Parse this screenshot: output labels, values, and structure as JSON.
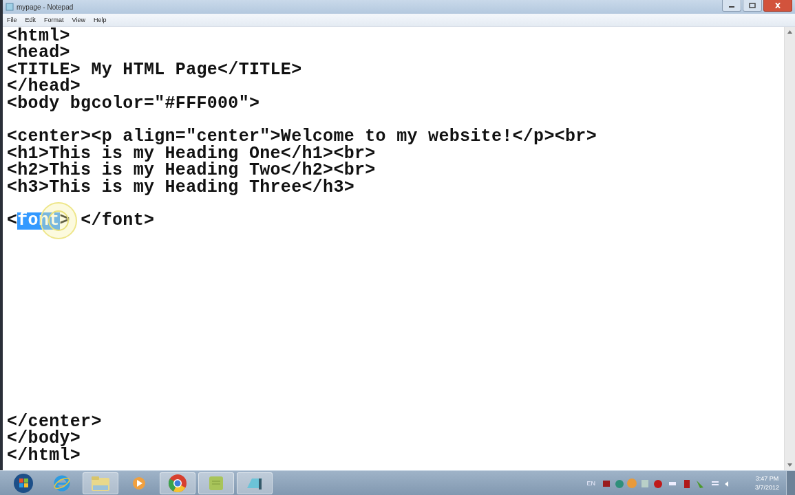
{
  "window": {
    "title": "mypage - Notepad"
  },
  "menu": [
    {
      "label": "File"
    },
    {
      "label": "Edit"
    },
    {
      "label": "Format"
    },
    {
      "label": "View"
    },
    {
      "label": "Help"
    }
  ],
  "editor": {
    "lines": [
      {
        "kind": "code",
        "text": "<html>"
      },
      {
        "kind": "code",
        "text": "<head>"
      },
      {
        "kind": "code",
        "text": "<TITLE> My HTML Page</TITLE>"
      },
      {
        "kind": "code",
        "text": "</head>"
      },
      {
        "kind": "code",
        "text": "<body bgcolor=\"#FFF000\">"
      },
      {
        "kind": "blank"
      },
      {
        "kind": "code",
        "text": "<center><p align=\"center\">Welcome to my website!</p><br>"
      },
      {
        "kind": "code",
        "text": "<h1>This is my Heading One</h1><br>"
      },
      {
        "kind": "code",
        "text": "<h2>This is my Heading Two</h2><br>"
      },
      {
        "kind": "code",
        "text": "<h3>This is my Heading Three</h3>"
      },
      {
        "kind": "blank"
      },
      {
        "kind": "parts",
        "parts": [
          {
            "text": "<",
            "selected": false
          },
          {
            "text": "font",
            "selected": true
          },
          {
            "text": "> </font>",
            "selected": false
          }
        ]
      },
      {
        "kind": "blank"
      },
      {
        "kind": "blank"
      },
      {
        "kind": "blank"
      },
      {
        "kind": "blank"
      },
      {
        "kind": "blank"
      },
      {
        "kind": "blank"
      },
      {
        "kind": "blank"
      },
      {
        "kind": "blank"
      },
      {
        "kind": "blank"
      },
      {
        "kind": "blank"
      },
      {
        "kind": "blank"
      },
      {
        "kind": "code",
        "text": "</center>"
      },
      {
        "kind": "code",
        "text": "</body>"
      },
      {
        "kind": "code",
        "text": "</html>"
      }
    ]
  },
  "taskbar": {
    "language": "EN",
    "time": "3:47 PM",
    "date": "3/7/2012"
  }
}
